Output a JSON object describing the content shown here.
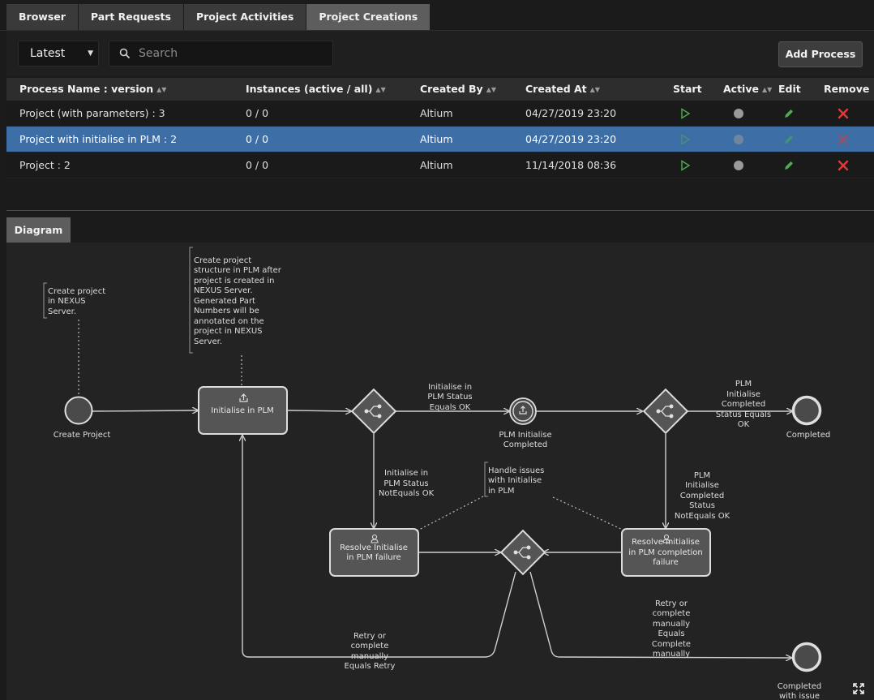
{
  "tabs": [
    {
      "label": "Browser"
    },
    {
      "label": "Part Requests"
    },
    {
      "label": "Project Activities"
    },
    {
      "label": "Project Creations"
    }
  ],
  "toolbar": {
    "version_select": "Latest",
    "search_placeholder": "Search",
    "add_button": "Add Process"
  },
  "table": {
    "headers": {
      "name": "Process Name : version",
      "instances": "Instances (active / all)",
      "created_by": "Created By",
      "created_at": "Created At",
      "start": "Start",
      "active": "Active",
      "edit": "Edit",
      "remove": "Remove"
    },
    "rows": [
      {
        "name": "Project (with parameters) : 3",
        "instances": "0 / 0",
        "created_by": "Altium",
        "created_at": "04/27/2019 23:20",
        "selected": false
      },
      {
        "name": "Project with initialise in PLM : 2",
        "instances": "0 / 0",
        "created_by": "Altium",
        "created_at": "04/27/2019 23:20",
        "selected": true
      },
      {
        "name": "Project : 2",
        "instances": "0 / 0",
        "created_by": "Altium",
        "created_at": "11/14/2018 08:36",
        "selected": false
      }
    ]
  },
  "diagram": {
    "tab_label": "Diagram",
    "annotations": {
      "create_project": [
        "Create project",
        "in NEXUS",
        "Server."
      ],
      "create_structure": [
        "Create project",
        "structure in PLM after",
        "project is created in",
        "NEXUS Server.",
        "Generated Part",
        "Numbers will be",
        "annotated on the",
        "project in NEXUS",
        "Server."
      ],
      "handle_issues": [
        "Handle issues",
        "with Initialise",
        "in PLM"
      ]
    },
    "nodes": {
      "start": "Create Project",
      "initialise": "Initialise in PLM",
      "plm_completed": [
        "PLM Initialise",
        "Completed"
      ],
      "completed": "Completed",
      "completed_issue": [
        "Completed",
        "with issue"
      ],
      "resolve_initialise": [
        "Resolve Initialise",
        "in PLM failure"
      ],
      "resolve_completion": [
        "Resolve Initialise",
        "in PLM completion",
        "failure"
      ]
    },
    "edges": {
      "status_ok": [
        "Initialise in",
        "PLM Status",
        "Equals OK"
      ],
      "completed_ok": [
        "PLM",
        "Initialise",
        "Completed",
        "Status Equals",
        "OK"
      ],
      "status_not_ok": [
        "Initialise in",
        "PLM Status",
        "NotEquals OK"
      ],
      "completed_not_ok": [
        "PLM",
        "Initialise",
        "Completed",
        "Status",
        "NotEquals OK"
      ],
      "retry": [
        "Retry or",
        "complete",
        "manually",
        "Equals Retry"
      ],
      "complete_manually": [
        "Retry or",
        "complete",
        "manually",
        "Equals",
        "Complete",
        "manually"
      ]
    }
  },
  "colors": {
    "selected_row": "#3e6ea6",
    "start_play": "#4caf50",
    "edit_pencil": "#4caf50",
    "remove_x": "#e53935",
    "active_dot": "#9a9a9a"
  }
}
